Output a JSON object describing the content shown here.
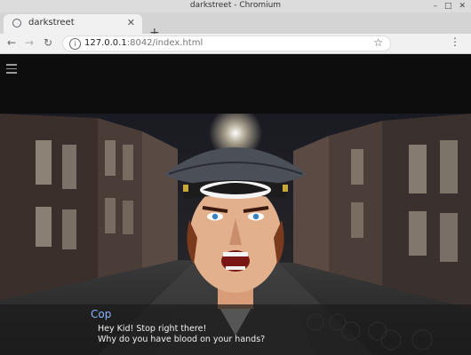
{
  "window": {
    "title": "darkstreet - Chromium",
    "controls": [
      "–",
      "□",
      "✕"
    ]
  },
  "tab": {
    "title": "darkstreet",
    "close": "✕",
    "icon": "globe-icon"
  },
  "newtab": {
    "label": "+"
  },
  "nav": {
    "back": "←",
    "forward": "→",
    "reload": "↻"
  },
  "address": {
    "host": "127.0.0.1",
    "rest": ":8042/index.html",
    "star": "☆",
    "info": "i"
  },
  "menu": {
    "dots": "⋮"
  },
  "dialog": {
    "speaker": "Cop",
    "lines": [
      "Hey Kid! Stop right there!",
      "Why do you have blood on your hands?"
    ]
  },
  "colors": {
    "speaker": "#8ab4ff",
    "page_bg": "#0d0d0d",
    "dialog_bg": "#1c1c1c"
  }
}
